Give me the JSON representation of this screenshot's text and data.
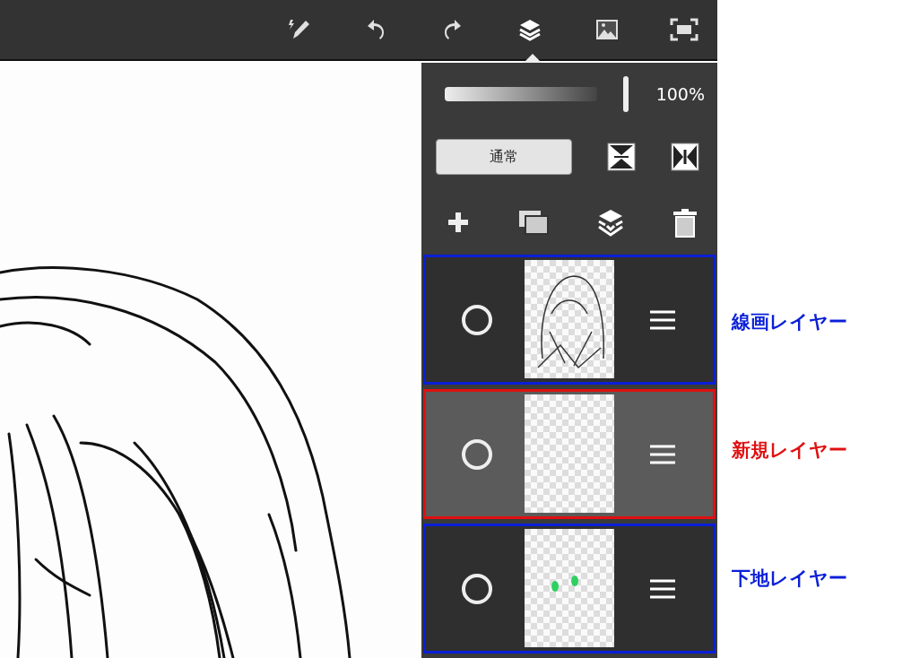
{
  "toolbar": {
    "buttons": [
      {
        "kind": "pen",
        "selected": false
      },
      {
        "kind": "undo",
        "selected": false
      },
      {
        "kind": "redo",
        "selected": false
      },
      {
        "kind": "layers",
        "selected": true
      },
      {
        "kind": "image",
        "selected": false
      },
      {
        "kind": "fullscreen",
        "selected": false
      }
    ]
  },
  "layer_panel": {
    "opacity": {
      "level": 1,
      "reading": "100%"
    },
    "blend_mode": "通常",
    "layers": [
      {
        "label": "線画レイヤー",
        "color": "#0a1fd8",
        "selected": false,
        "kind": "sketch"
      },
      {
        "label": "新規レイヤー",
        "color": "#e01010",
        "selected": true,
        "kind": "empty"
      },
      {
        "label": "下地レイヤー",
        "color": "#0a1fd8",
        "selected": false,
        "kind": "marks"
      }
    ]
  }
}
